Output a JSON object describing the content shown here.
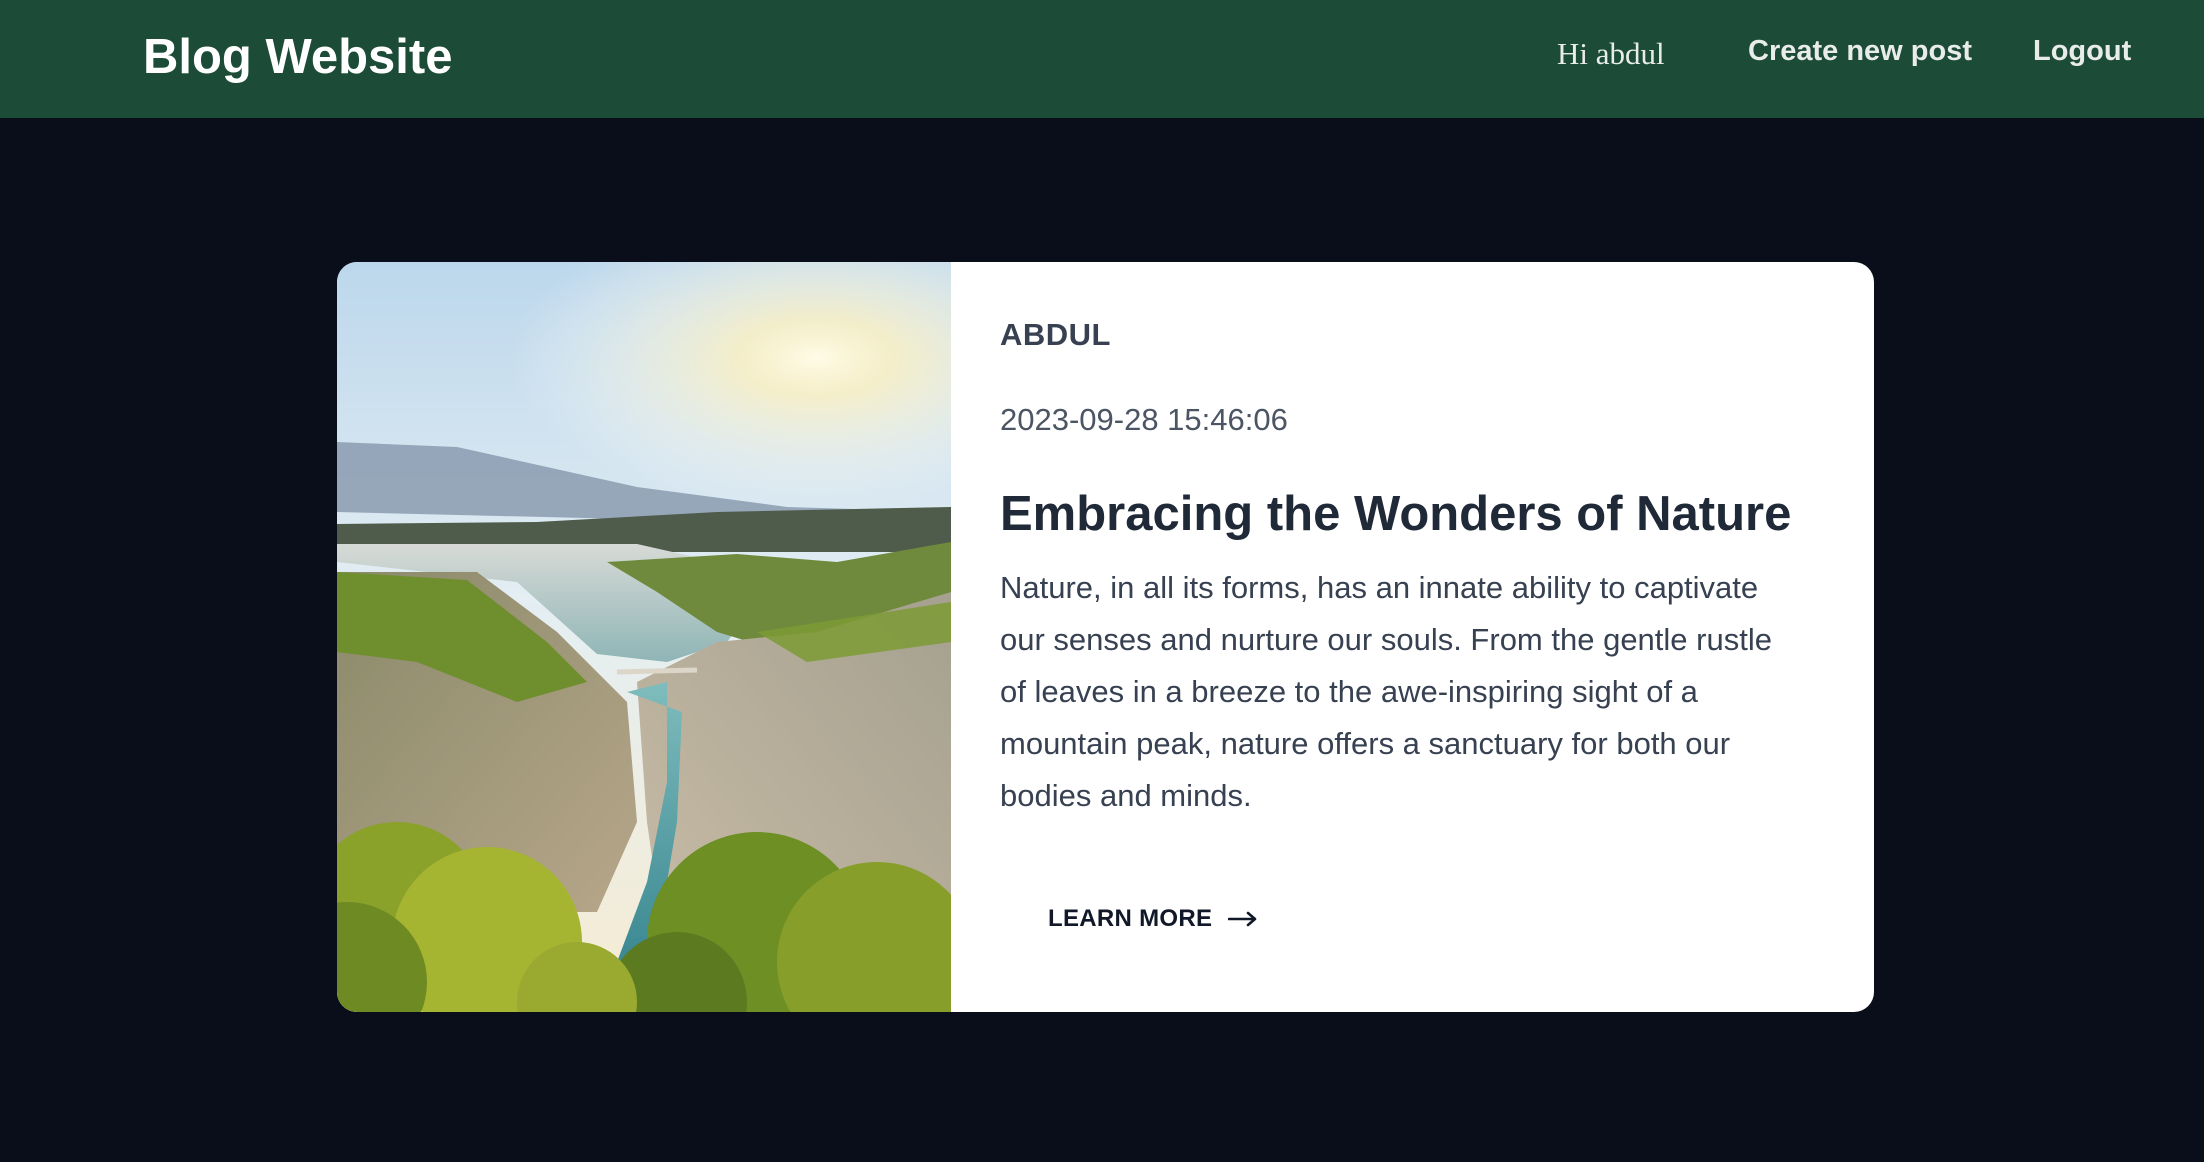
{
  "navbar": {
    "brand": "Blog Website",
    "greeting": "Hi abdul",
    "create_label": "Create new post",
    "logout_label": "Logout",
    "background_color": "#1c4b37"
  },
  "post": {
    "author": "ABDUL",
    "timestamp": "2023-09-28 15:46:06",
    "title": "Embracing the Wonders of Nature",
    "excerpt": "Nature, in all its forms, has an innate ability to captivate our senses and nurture our souls. From the gentle rustle of leaves in a breeze to the awe-inspiring sight of a mountain peak, nature offers a sanctuary for both our bodies and minds.",
    "cta_label": "LEARN MORE",
    "cta_icon": "arrow-right-icon",
    "image_subject": "canyon-landscape"
  },
  "colors": {
    "page_background": "#0a0e1b",
    "card_background": "#ffffff"
  }
}
